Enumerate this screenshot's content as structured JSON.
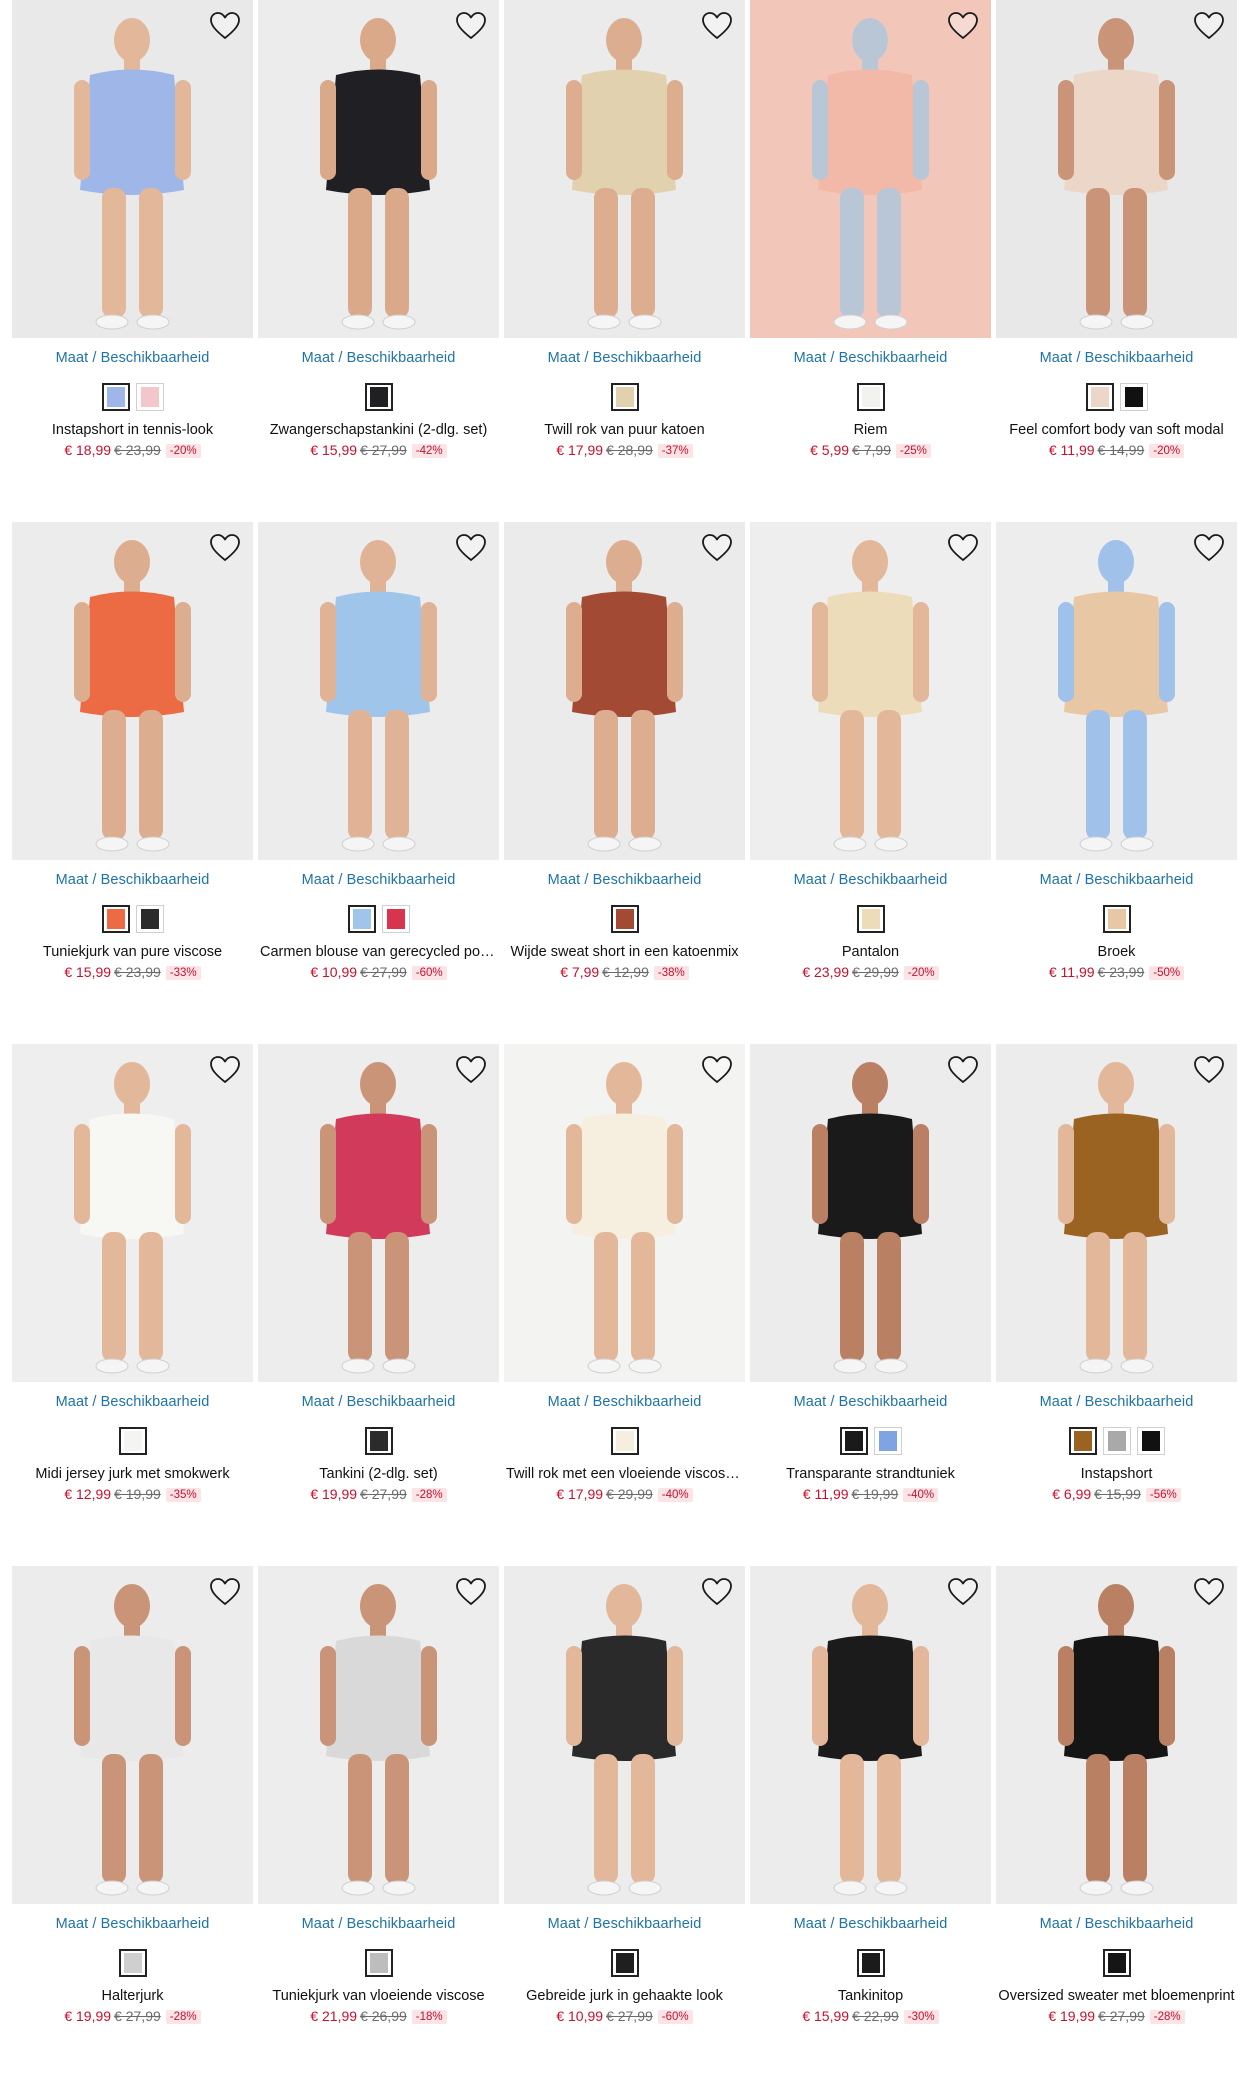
{
  "size_link_label": "Maat / Beschikbaarheid",
  "products": [
    {
      "name": "Instapshort in tennis-look",
      "price": "€ 18,99",
      "old_price": "€ 23,99",
      "discount": "-20%",
      "bg": "#e9e9e9",
      "garment": "#9fb7e8",
      "skin": "#e2b79a",
      "swatches": [
        "#9fb7e8",
        "#f3c6c9"
      ]
    },
    {
      "name": "Zwangerschapstankini (2-dlg. set)",
      "price": "€ 15,99",
      "old_price": "€ 27,99",
      "discount": "-42%",
      "bg": "#ececec",
      "garment": "#1f1f24",
      "skin": "#d9a98a",
      "swatches": [
        "#1f1f24"
      ]
    },
    {
      "name": "Twill rok van puur katoen",
      "price": "€ 17,99",
      "old_price": "€ 28,99",
      "discount": "-37%",
      "bg": "#ebebeb",
      "garment": "#e2d1ae",
      "skin": "#dcae8f",
      "swatches": [
        "#e2d1ae"
      ]
    },
    {
      "name": "Riem",
      "price": "€ 5,99",
      "old_price": "€ 7,99",
      "discount": "-25%",
      "bg": "#f2c7b9",
      "garment": "#f3b9a8",
      "skin": "#b8c6d6",
      "swatches": [
        "#f2f2ee"
      ]
    },
    {
      "name": "Feel comfort body van soft modal",
      "price": "€ 11,99",
      "old_price": "€ 14,99",
      "discount": "-20%",
      "bg": "#e8e8e8",
      "garment": "#ecd6c8",
      "skin": "#c99477",
      "swatches": [
        "#ecd6c8",
        "#111111"
      ]
    },
    {
      "name": "Tuniekjurk van pure viscose",
      "price": "€ 15,99",
      "old_price": "€ 23,99",
      "discount": "-33%",
      "bg": "#ececec",
      "garment": "#ec6a44",
      "skin": "#dcae8f",
      "swatches": [
        "#ec6a44",
        "#2b2b2b"
      ]
    },
    {
      "name": "Carmen blouse van gerecycled polyester",
      "price": "€ 10,99",
      "old_price": "€ 27,99",
      "discount": "-60%",
      "bg": "#ececec",
      "garment": "#9fc6ea",
      "skin": "#e0b397",
      "swatches": [
        "#9fc6ea",
        "#d9344f"
      ]
    },
    {
      "name": "Wijde sweat short in een katoenmix",
      "price": "€ 7,99",
      "old_price": "€ 12,99",
      "discount": "-38%",
      "bg": "#ebebeb",
      "garment": "#a24a33",
      "skin": "#dcae8f",
      "swatches": [
        "#a24a33"
      ]
    },
    {
      "name": "Pantalon",
      "price": "€ 23,99",
      "old_price": "€ 29,99",
      "discount": "-20%",
      "bg": "#eeeeee",
      "garment": "#ecdcb9",
      "skin": "#e2b79a",
      "swatches": [
        "#ecdcb9"
      ]
    },
    {
      "name": "Broek",
      "price": "€ 11,99",
      "old_price": "€ 23,99",
      "discount": "-50%",
      "bg": "#ededed",
      "garment": "#e7c7a4",
      "skin": "#9fc1ea",
      "swatches": [
        "#e7c7a4"
      ]
    },
    {
      "name": "Midi jersey jurk met smokwerk",
      "price": "€ 12,99",
      "old_price": "€ 19,99",
      "discount": "-35%",
      "bg": "#eeeeee",
      "garment": "#f7f7f4",
      "skin": "#e2b79a",
      "swatches": [
        "#f4f4f0"
      ]
    },
    {
      "name": "Tankini (2-dlg. set)",
      "price": "€ 19,99",
      "old_price": "€ 27,99",
      "discount": "-28%",
      "bg": "#ededed",
      "garment": "#d23a5b",
      "skin": "#c99477",
      "swatches": [
        "#2b2b2b"
      ]
    },
    {
      "name": "Twill rok met een vloeiende viscose look",
      "price": "€ 17,99",
      "old_price": "€ 29,99",
      "discount": "-40%",
      "bg": "#f3f3f1",
      "garment": "#f6efe0",
      "skin": "#e2b79a",
      "swatches": [
        "#f6efe0"
      ]
    },
    {
      "name": "Transparante strandtuniek",
      "price": "€ 11,99",
      "old_price": "€ 19,99",
      "discount": "-40%",
      "bg": "#ececec",
      "garment": "#1a1a1a",
      "skin": "#b98064",
      "swatches": [
        "#1a1a1a",
        "#7fa3e3"
      ]
    },
    {
      "name": "Instapshort",
      "price": "€ 6,99",
      "old_price": "€ 15,99",
      "discount": "-56%",
      "bg": "#ececec",
      "garment": "#9a6322",
      "skin": "#e2b79a",
      "swatches": [
        "#9a6322",
        "#a9a9a9",
        "#111111"
      ]
    },
    {
      "name": "Halterjurk",
      "price": "€ 19,99",
      "old_price": "€ 27,99",
      "discount": "-28%",
      "bg": "#ececec",
      "garment": "#e8e8e8",
      "skin": "#c99477",
      "swatches": [
        "#cfcfcf"
      ]
    },
    {
      "name": "Tuniekjurk van vloeiende viscose",
      "price": "€ 21,99",
      "old_price": "€ 26,99",
      "discount": "-18%",
      "bg": "#ededed",
      "garment": "#d9d9d9",
      "skin": "#c99477",
      "swatches": [
        "#bdbdbd"
      ]
    },
    {
      "name": "Gebreide jurk in gehaakte look",
      "price": "€ 10,99",
      "old_price": "€ 27,99",
      "discount": "-60%",
      "bg": "#ececec",
      "garment": "#2a2a2a",
      "skin": "#e2b79a",
      "swatches": [
        "#1f1f1f"
      ]
    },
    {
      "name": "Tankinitop",
      "price": "€ 15,99",
      "old_price": "€ 22,99",
      "discount": "-30%",
      "bg": "#ececec",
      "garment": "#1b1b1b",
      "skin": "#e2b79a",
      "swatches": [
        "#1b1b1b"
      ]
    },
    {
      "name": "Oversized sweater met bloemenprint",
      "price": "€ 19,99",
      "old_price": "€ 27,99",
      "discount": "-28%",
      "bg": "#ececec",
      "garment": "#151515",
      "skin": "#b98064",
      "swatches": [
        "#151515"
      ]
    }
  ]
}
